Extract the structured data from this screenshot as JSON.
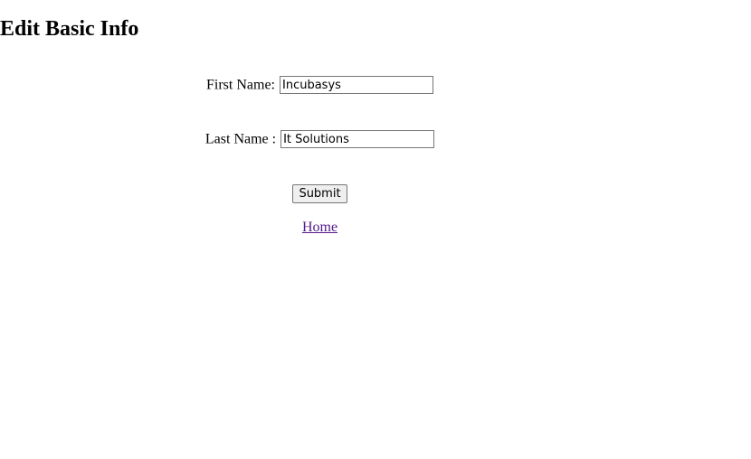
{
  "page": {
    "title": "Edit Basic Info"
  },
  "form": {
    "first_name_label": "First Name:",
    "first_name_value": "Incubasys",
    "last_name_label": "Last Name :",
    "last_name_value": "It Solutions",
    "submit_label": "Submit"
  },
  "nav": {
    "home_label": "Home"
  }
}
